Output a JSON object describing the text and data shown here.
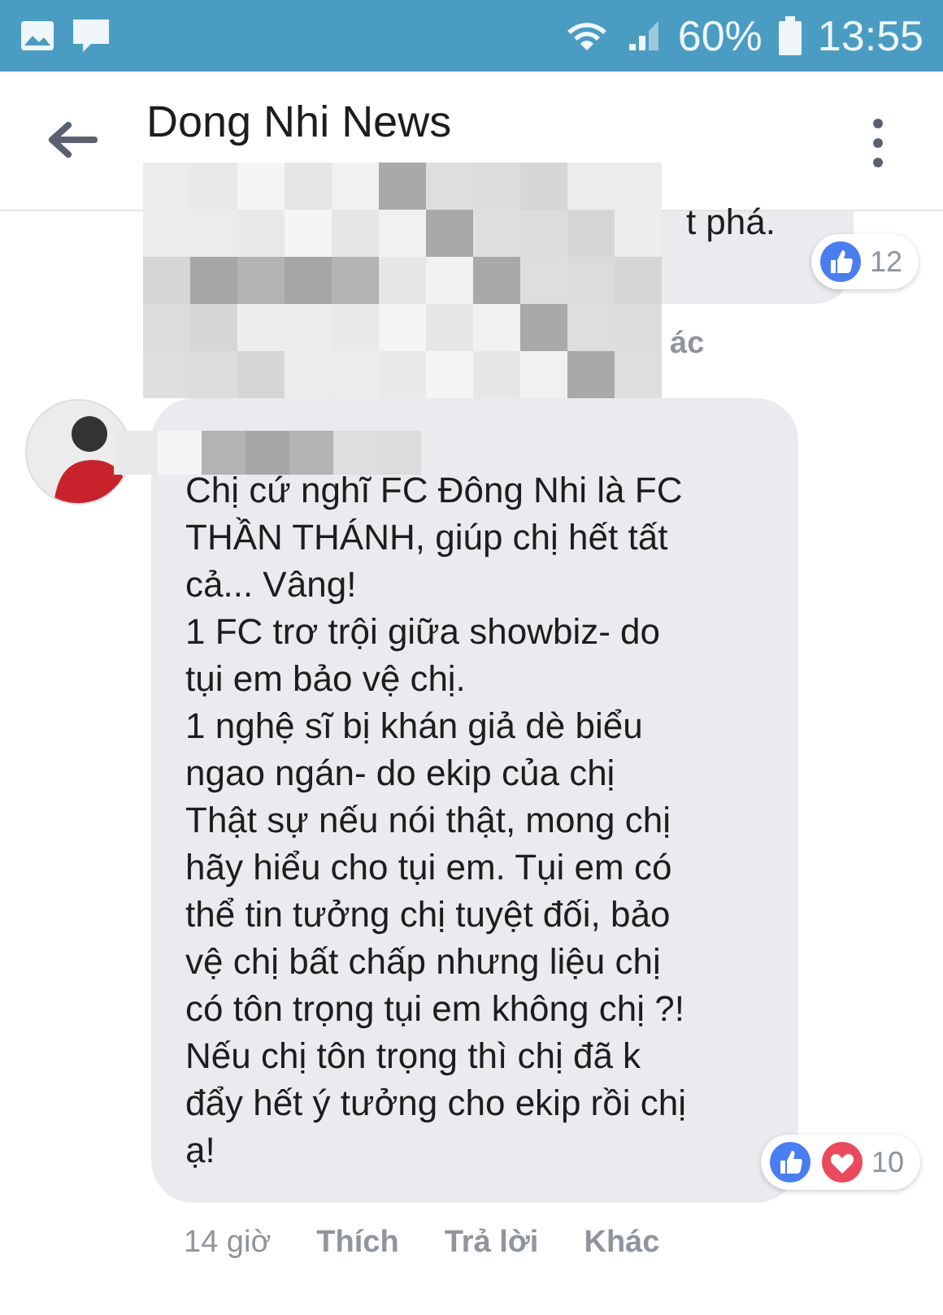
{
  "status_bar": {
    "battery": "60%",
    "time": "13:55"
  },
  "header": {
    "title": "Dong Nhi News"
  },
  "comments": [
    {
      "lines": [
        "t phá."
      ],
      "reactions": [
        {
          "kind": "like"
        }
      ],
      "reaction_count": "12",
      "actions": [
        "ác"
      ]
    },
    {
      "lines": [
        "Chị cứ nghĩ FC Đông Nhi là FC",
        "THẦN THÁNH, giúp chị hết tất",
        "cả... Vâng!",
        "1 FC trơ trội giữa showbiz- do",
        "tụi em bảo vệ chị.",
        "1 nghệ sĩ bị khán giả dè biểu",
        "ngao ngán- do ekip của chị",
        "Thật sự nếu nói thật, mong chị",
        "hãy hiểu cho tụi em. Tụi em có",
        "thể tin tưởng chị tuyệt đối, bảo",
        "vệ chị bất chấp nhưng liệu chị",
        "có tôn trọng tụi em không chị ?!",
        "Nếu chị tôn trọng thì chị đã k",
        "đẩy hết ý tưởng cho ekip rồi chị",
        "ạ!"
      ],
      "reactions": [
        {
          "kind": "like"
        },
        {
          "kind": "love"
        }
      ],
      "reaction_count": "10",
      "time": "14 giờ",
      "actions": [
        "Thích",
        "Trả lời",
        "Khác"
      ]
    }
  ]
}
